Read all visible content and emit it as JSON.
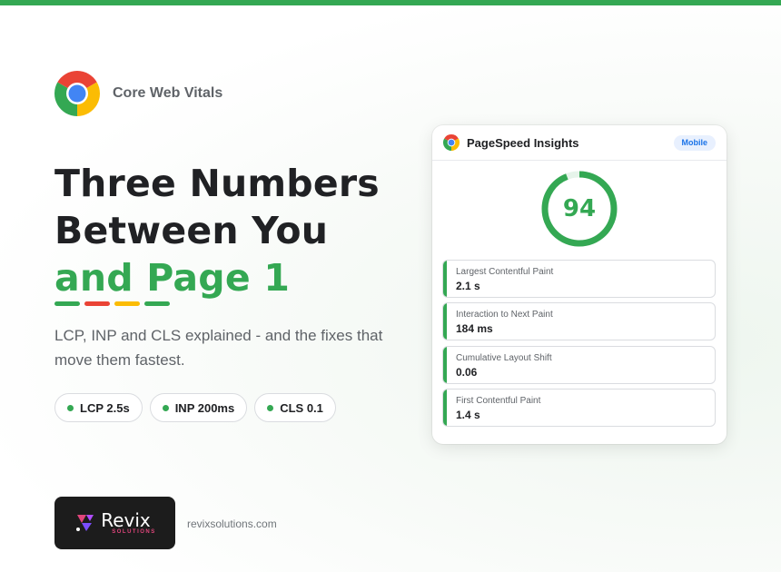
{
  "theme": {
    "accent": "#34a853",
    "red": "#ea4335",
    "yellow": "#fbbc04",
    "blue": "#4285f4"
  },
  "brand": {
    "label": "Core Web Vitals",
    "icon": "chrome-icon"
  },
  "headline": {
    "line1": "Three Numbers",
    "line2": "Between You",
    "line3": "and Page 1"
  },
  "subtitle": "LCP, INP and CLS explained - and the fixes that move them fastest.",
  "chips": [
    {
      "label": "LCP 2.5s"
    },
    {
      "label": "INP 200ms"
    },
    {
      "label": "CLS 0.1"
    }
  ],
  "footer": {
    "logo_name": "Revix",
    "logo_sub": "SOLUTIONS",
    "site": "revixsolutions.com"
  },
  "card": {
    "title": "PageSpeed Insights",
    "badge": "Mobile",
    "score": "94",
    "score_fraction": 0.94,
    "metrics": [
      {
        "label": "Largest Contentful Paint",
        "value": "2.1 s"
      },
      {
        "label": "Interaction to Next Paint",
        "value": "184 ms"
      },
      {
        "label": "Cumulative Layout Shift",
        "value": "0.06"
      },
      {
        "label": "First Contentful Paint",
        "value": "1.4 s"
      }
    ]
  }
}
